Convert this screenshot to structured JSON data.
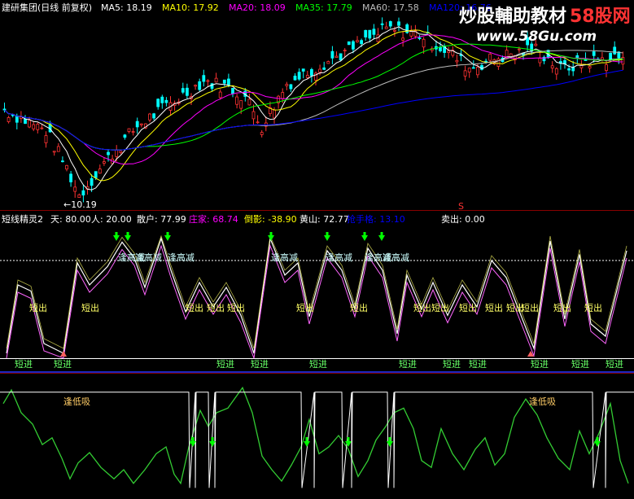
{
  "watermark": {
    "text_cn": "炒股輔助教材",
    "brand": "58股网",
    "url": "www.58Gu.com"
  },
  "colors": {
    "background": "#000000",
    "up": "#ff3232",
    "down": "#00ffff",
    "ma5": "#ffffff",
    "ma10": "#ffff00",
    "ma20": "#ff00ff",
    "ma35": "#00ff00",
    "ma60": "#bbbbbb",
    "ma120": "#0000ff",
    "green_line": "#33cc33",
    "sell_arrow": "#00ff00",
    "buy_arrow": "#ff6060"
  },
  "chart_data": [
    {
      "type": "candlestick",
      "panel": "price",
      "title": "建研集团(日线 前复权)",
      "legend": [
        {
          "label": "MA5:",
          "value": "18.19",
          "color": "#ffffff"
        },
        {
          "label": "MA10:",
          "value": "17.92",
          "color": "#ffff00"
        },
        {
          "label": "MA20:",
          "value": "18.09",
          "color": "#ff00ff"
        },
        {
          "label": "MA35:",
          "value": "17.79",
          "color": "#00ff00"
        },
        {
          "label": "MA60:",
          "value": "17.58",
          "color": "#bbbbbb"
        },
        {
          "label": "MA120:",
          "value": "16.76",
          "color": "#0000ff"
        }
      ],
      "annotations": {
        "low_label": "10.19",
        "marker_s": "S"
      },
      "ylim": [
        10,
        22
      ]
    },
    {
      "type": "line",
      "panel": "oscillator",
      "legend": [
        {
          "label": "短线精灵2",
          "value": "",
          "color": "#ffffff"
        },
        {
          "label": "天:",
          "value": "80.00",
          "color": "#ffffff"
        },
        {
          "label": "人:",
          "value": "20.00",
          "color": "#ffffff"
        },
        {
          "label": "散户:",
          "value": "77.99",
          "color": "#ffffff"
        },
        {
          "label": "庄家:",
          "value": "68.74",
          "color": "#ff00ff"
        },
        {
          "label": "倒影:",
          "value": "-38.90",
          "color": "#ffff00"
        },
        {
          "label": "黄山:",
          "value": "72.77",
          "color": "#ffffff"
        },
        {
          "label": "抢手格:",
          "value": "13.10",
          "color": "#0000ff"
        },
        {
          "label": "卖出:",
          "value": "0.00",
          "color": "#ffffff"
        }
      ],
      "sell_label": "逢高减",
      "buy_label": "短进",
      "exit_label": "短出",
      "levels": {
        "top": 80,
        "bottom": 20
      }
    },
    {
      "type": "line",
      "panel": "bottom",
      "label": "逢低吸"
    }
  ]
}
